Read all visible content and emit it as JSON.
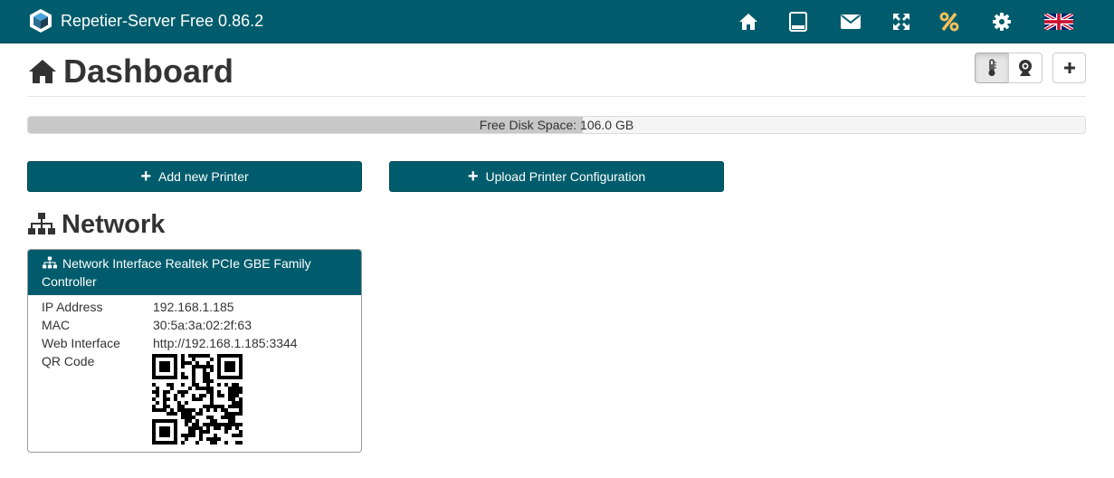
{
  "app": {
    "title": "Repetier-Server Free 0.86.2"
  },
  "nav": {
    "icons": [
      "home-icon",
      "tablet-icon",
      "envelope-icon",
      "fullscreen-icon",
      "percent-icon",
      "gear-icon",
      "uk-flag-icon"
    ],
    "accent_icon_color": "#f5c05a"
  },
  "page": {
    "title": "Dashboard"
  },
  "disk": {
    "label": "Free Disk Space: 106.0 GB",
    "used_fraction": 0.525
  },
  "actions": {
    "add_printer": "Add new Printer",
    "upload_config": "Upload Printer Configuration"
  },
  "network": {
    "title": "Network",
    "panel_title": "Network Interface Realtek PCIe GBE Family Controller",
    "rows": [
      {
        "key": "IP Address",
        "value": "192.168.1.185"
      },
      {
        "key": "MAC",
        "value": "30:5a:3a:02:2f:63"
      },
      {
        "key": "Web Interface",
        "value": "http://192.168.1.185:3344"
      },
      {
        "key": "QR Code",
        "value": ""
      }
    ]
  },
  "colors": {
    "brand": "#005c6c",
    "white": "#ffffff"
  }
}
